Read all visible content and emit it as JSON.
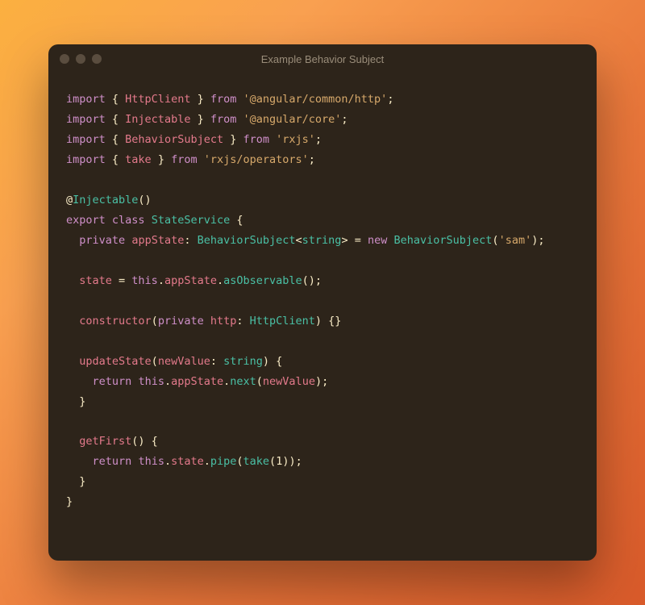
{
  "window": {
    "title": "Example Behavior Subject"
  },
  "code": {
    "tokens": [
      [
        {
          "t": "import",
          "c": "kw"
        },
        {
          "t": " { "
        },
        {
          "t": "HttpClient",
          "c": "prop"
        },
        {
          "t": " } "
        },
        {
          "t": "from",
          "c": "kw"
        },
        {
          "t": " "
        },
        {
          "t": "'@angular/common/http'",
          "c": "str"
        },
        {
          "t": ";"
        }
      ],
      [
        {
          "t": "import",
          "c": "kw"
        },
        {
          "t": " { "
        },
        {
          "t": "Injectable",
          "c": "prop"
        },
        {
          "t": " } "
        },
        {
          "t": "from",
          "c": "kw"
        },
        {
          "t": " "
        },
        {
          "t": "'@angular/core'",
          "c": "str"
        },
        {
          "t": ";"
        }
      ],
      [
        {
          "t": "import",
          "c": "kw"
        },
        {
          "t": " { "
        },
        {
          "t": "BehaviorSubject",
          "c": "prop"
        },
        {
          "t": " } "
        },
        {
          "t": "from",
          "c": "kw"
        },
        {
          "t": " "
        },
        {
          "t": "'rxjs'",
          "c": "str"
        },
        {
          "t": ";"
        }
      ],
      [
        {
          "t": "import",
          "c": "kw"
        },
        {
          "t": " { "
        },
        {
          "t": "take",
          "c": "prop"
        },
        {
          "t": " } "
        },
        {
          "t": "from",
          "c": "kw"
        },
        {
          "t": " "
        },
        {
          "t": "'rxjs/operators'",
          "c": "str"
        },
        {
          "t": ";"
        }
      ],
      [],
      [
        {
          "t": "@",
          "c": "dim"
        },
        {
          "t": "Injectable",
          "c": "fn"
        },
        {
          "t": "()"
        }
      ],
      [
        {
          "t": "export",
          "c": "kw"
        },
        {
          "t": " "
        },
        {
          "t": "class",
          "c": "kw"
        },
        {
          "t": " "
        },
        {
          "t": "StateService",
          "c": "fn"
        },
        {
          "t": " {"
        }
      ],
      [
        {
          "t": "  "
        },
        {
          "t": "private",
          "c": "kw"
        },
        {
          "t": " "
        },
        {
          "t": "appState",
          "c": "prop"
        },
        {
          "t": ": "
        },
        {
          "t": "BehaviorSubject",
          "c": "type"
        },
        {
          "t": "<"
        },
        {
          "t": "string",
          "c": "type"
        },
        {
          "t": "> = "
        },
        {
          "t": "new",
          "c": "kw"
        },
        {
          "t": " "
        },
        {
          "t": "BehaviorSubject",
          "c": "fn"
        },
        {
          "t": "("
        },
        {
          "t": "'sam'",
          "c": "str"
        },
        {
          "t": ");"
        }
      ],
      [],
      [
        {
          "t": "  "
        },
        {
          "t": "state",
          "c": "prop"
        },
        {
          "t": " = "
        },
        {
          "t": "this",
          "c": "kw"
        },
        {
          "t": "."
        },
        {
          "t": "appState",
          "c": "prop"
        },
        {
          "t": "."
        },
        {
          "t": "asObservable",
          "c": "fn"
        },
        {
          "t": "();"
        }
      ],
      [],
      [
        {
          "t": "  "
        },
        {
          "t": "constructor",
          "c": "prop"
        },
        {
          "t": "("
        },
        {
          "t": "private",
          "c": "kw"
        },
        {
          "t": " "
        },
        {
          "t": "http",
          "c": "prop"
        },
        {
          "t": ": "
        },
        {
          "t": "HttpClient",
          "c": "type"
        },
        {
          "t": ") {}"
        }
      ],
      [],
      [
        {
          "t": "  "
        },
        {
          "t": "updateState",
          "c": "prop"
        },
        {
          "t": "("
        },
        {
          "t": "newValue",
          "c": "prop"
        },
        {
          "t": ": "
        },
        {
          "t": "string",
          "c": "type"
        },
        {
          "t": ") {"
        }
      ],
      [
        {
          "t": "    "
        },
        {
          "t": "return",
          "c": "kw"
        },
        {
          "t": " "
        },
        {
          "t": "this",
          "c": "kw"
        },
        {
          "t": "."
        },
        {
          "t": "appState",
          "c": "prop"
        },
        {
          "t": "."
        },
        {
          "t": "next",
          "c": "fn"
        },
        {
          "t": "("
        },
        {
          "t": "newValue",
          "c": "prop"
        },
        {
          "t": ");"
        }
      ],
      [
        {
          "t": "  }"
        }
      ],
      [],
      [
        {
          "t": "  "
        },
        {
          "t": "getFirst",
          "c": "prop"
        },
        {
          "t": "() {"
        }
      ],
      [
        {
          "t": "    "
        },
        {
          "t": "return",
          "c": "kw"
        },
        {
          "t": " "
        },
        {
          "t": "this",
          "c": "kw"
        },
        {
          "t": "."
        },
        {
          "t": "state",
          "c": "prop"
        },
        {
          "t": "."
        },
        {
          "t": "pipe",
          "c": "fn"
        },
        {
          "t": "("
        },
        {
          "t": "take",
          "c": "fn"
        },
        {
          "t": "("
        },
        {
          "t": "1"
        },
        {
          "t": "));"
        }
      ],
      [
        {
          "t": "  }"
        }
      ],
      [
        {
          "t": "}"
        }
      ]
    ]
  }
}
